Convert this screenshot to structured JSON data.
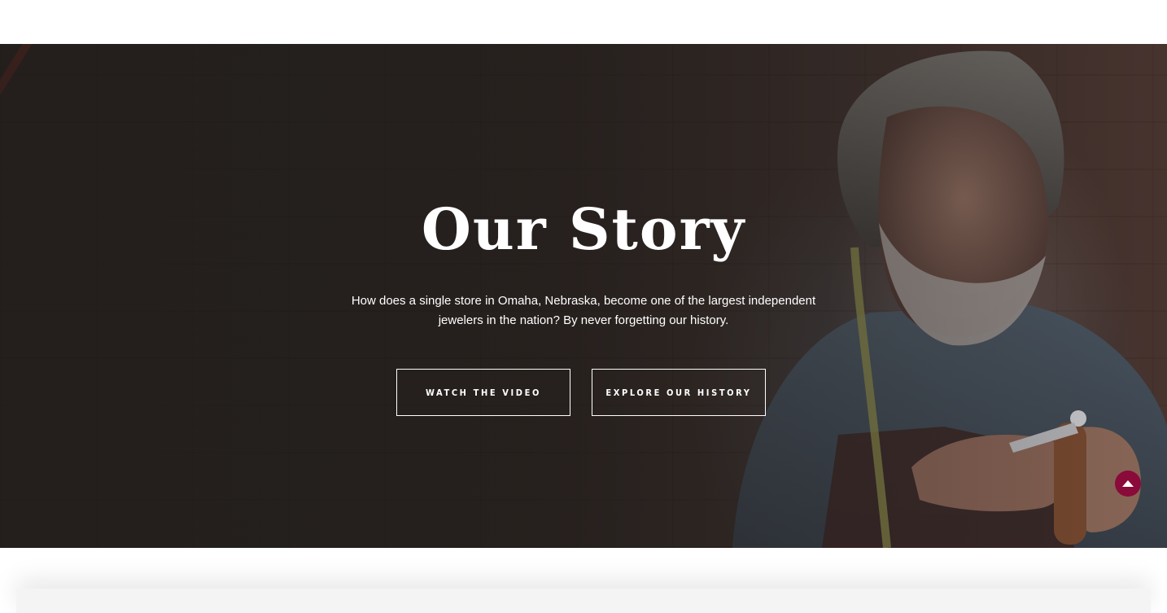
{
  "hero": {
    "title": "Our Story",
    "description": "How does a single store in Omaha, Nebraska, become one of the largest independent jewelers in the nation? By never forgetting our history.",
    "buttons": {
      "watch_video": "WATCH THE VIDEO",
      "explore_history": "EXPLORE OUR HISTORY"
    }
  },
  "icons": {
    "scroll_top": "chevron-up-icon"
  },
  "colors": {
    "accent": "#8a0a3a",
    "hero_overlay": "#2b2522",
    "text_on_hero": "#ffffff"
  }
}
